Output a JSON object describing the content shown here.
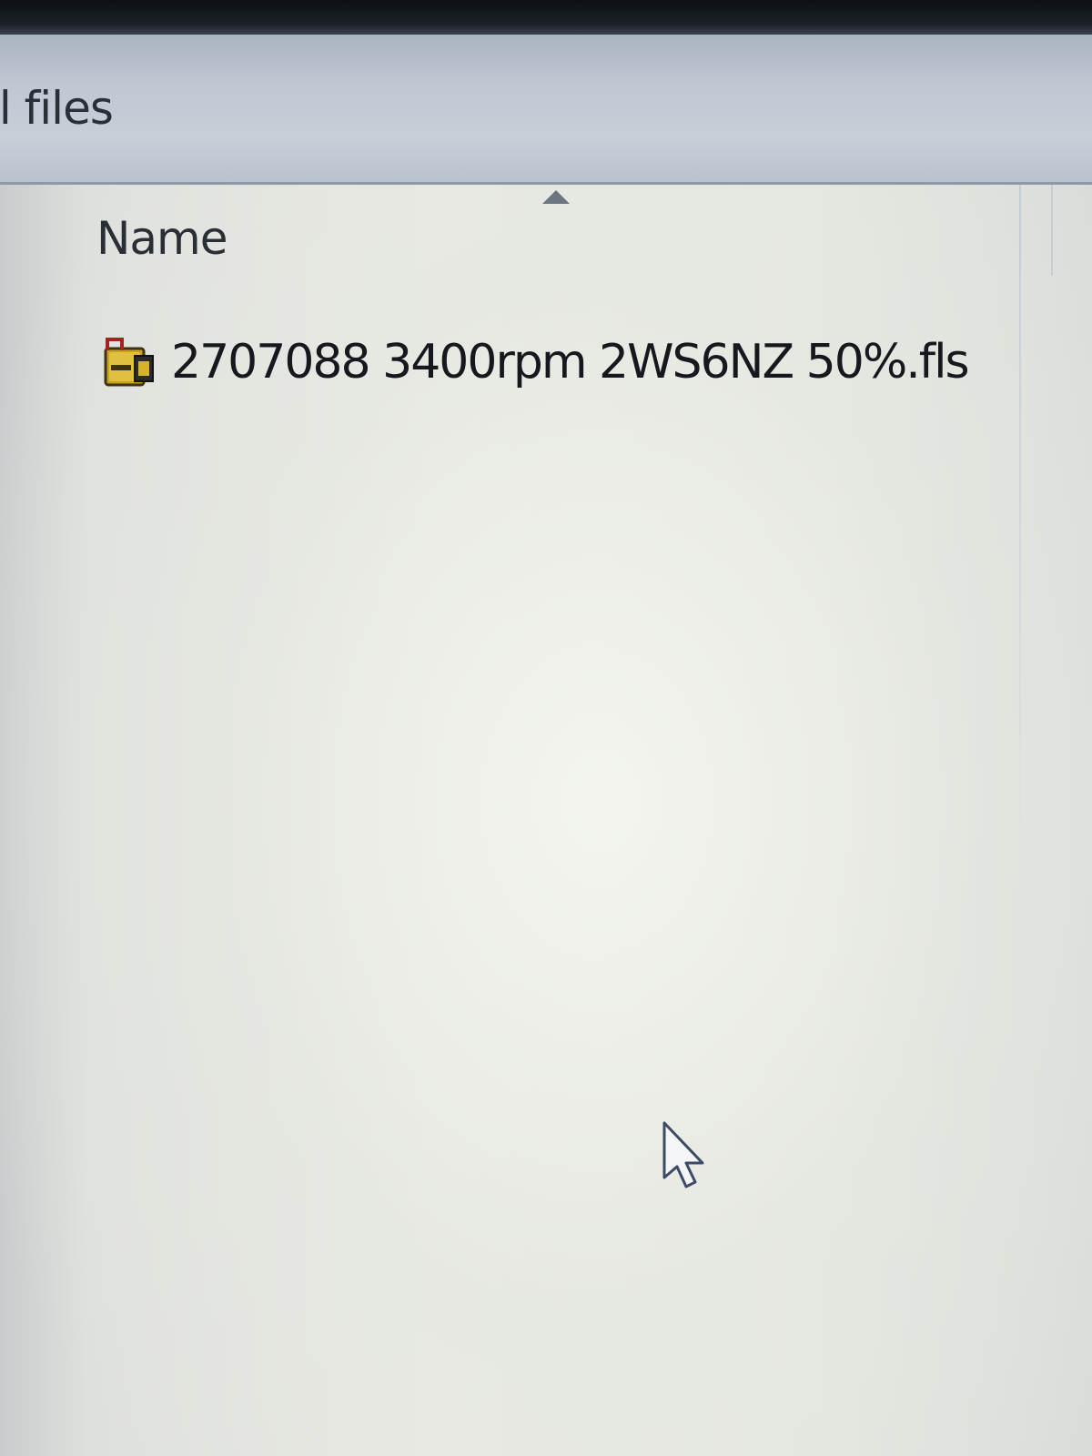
{
  "window": {
    "title": "ll files"
  },
  "file_list": {
    "columns": [
      {
        "label": "Name",
        "sorted": "ascending"
      }
    ],
    "rows": [
      {
        "name": "2707088 3400rpm 2WS6NZ 50%.fls",
        "icon": "fls-file-icon"
      }
    ]
  },
  "cursor": {
    "icon": "mouse-pointer-icon"
  },
  "colors": {
    "title_bar": "#bfc8d3",
    "pane_background": "#e4e6e0",
    "text": "#15181d"
  }
}
